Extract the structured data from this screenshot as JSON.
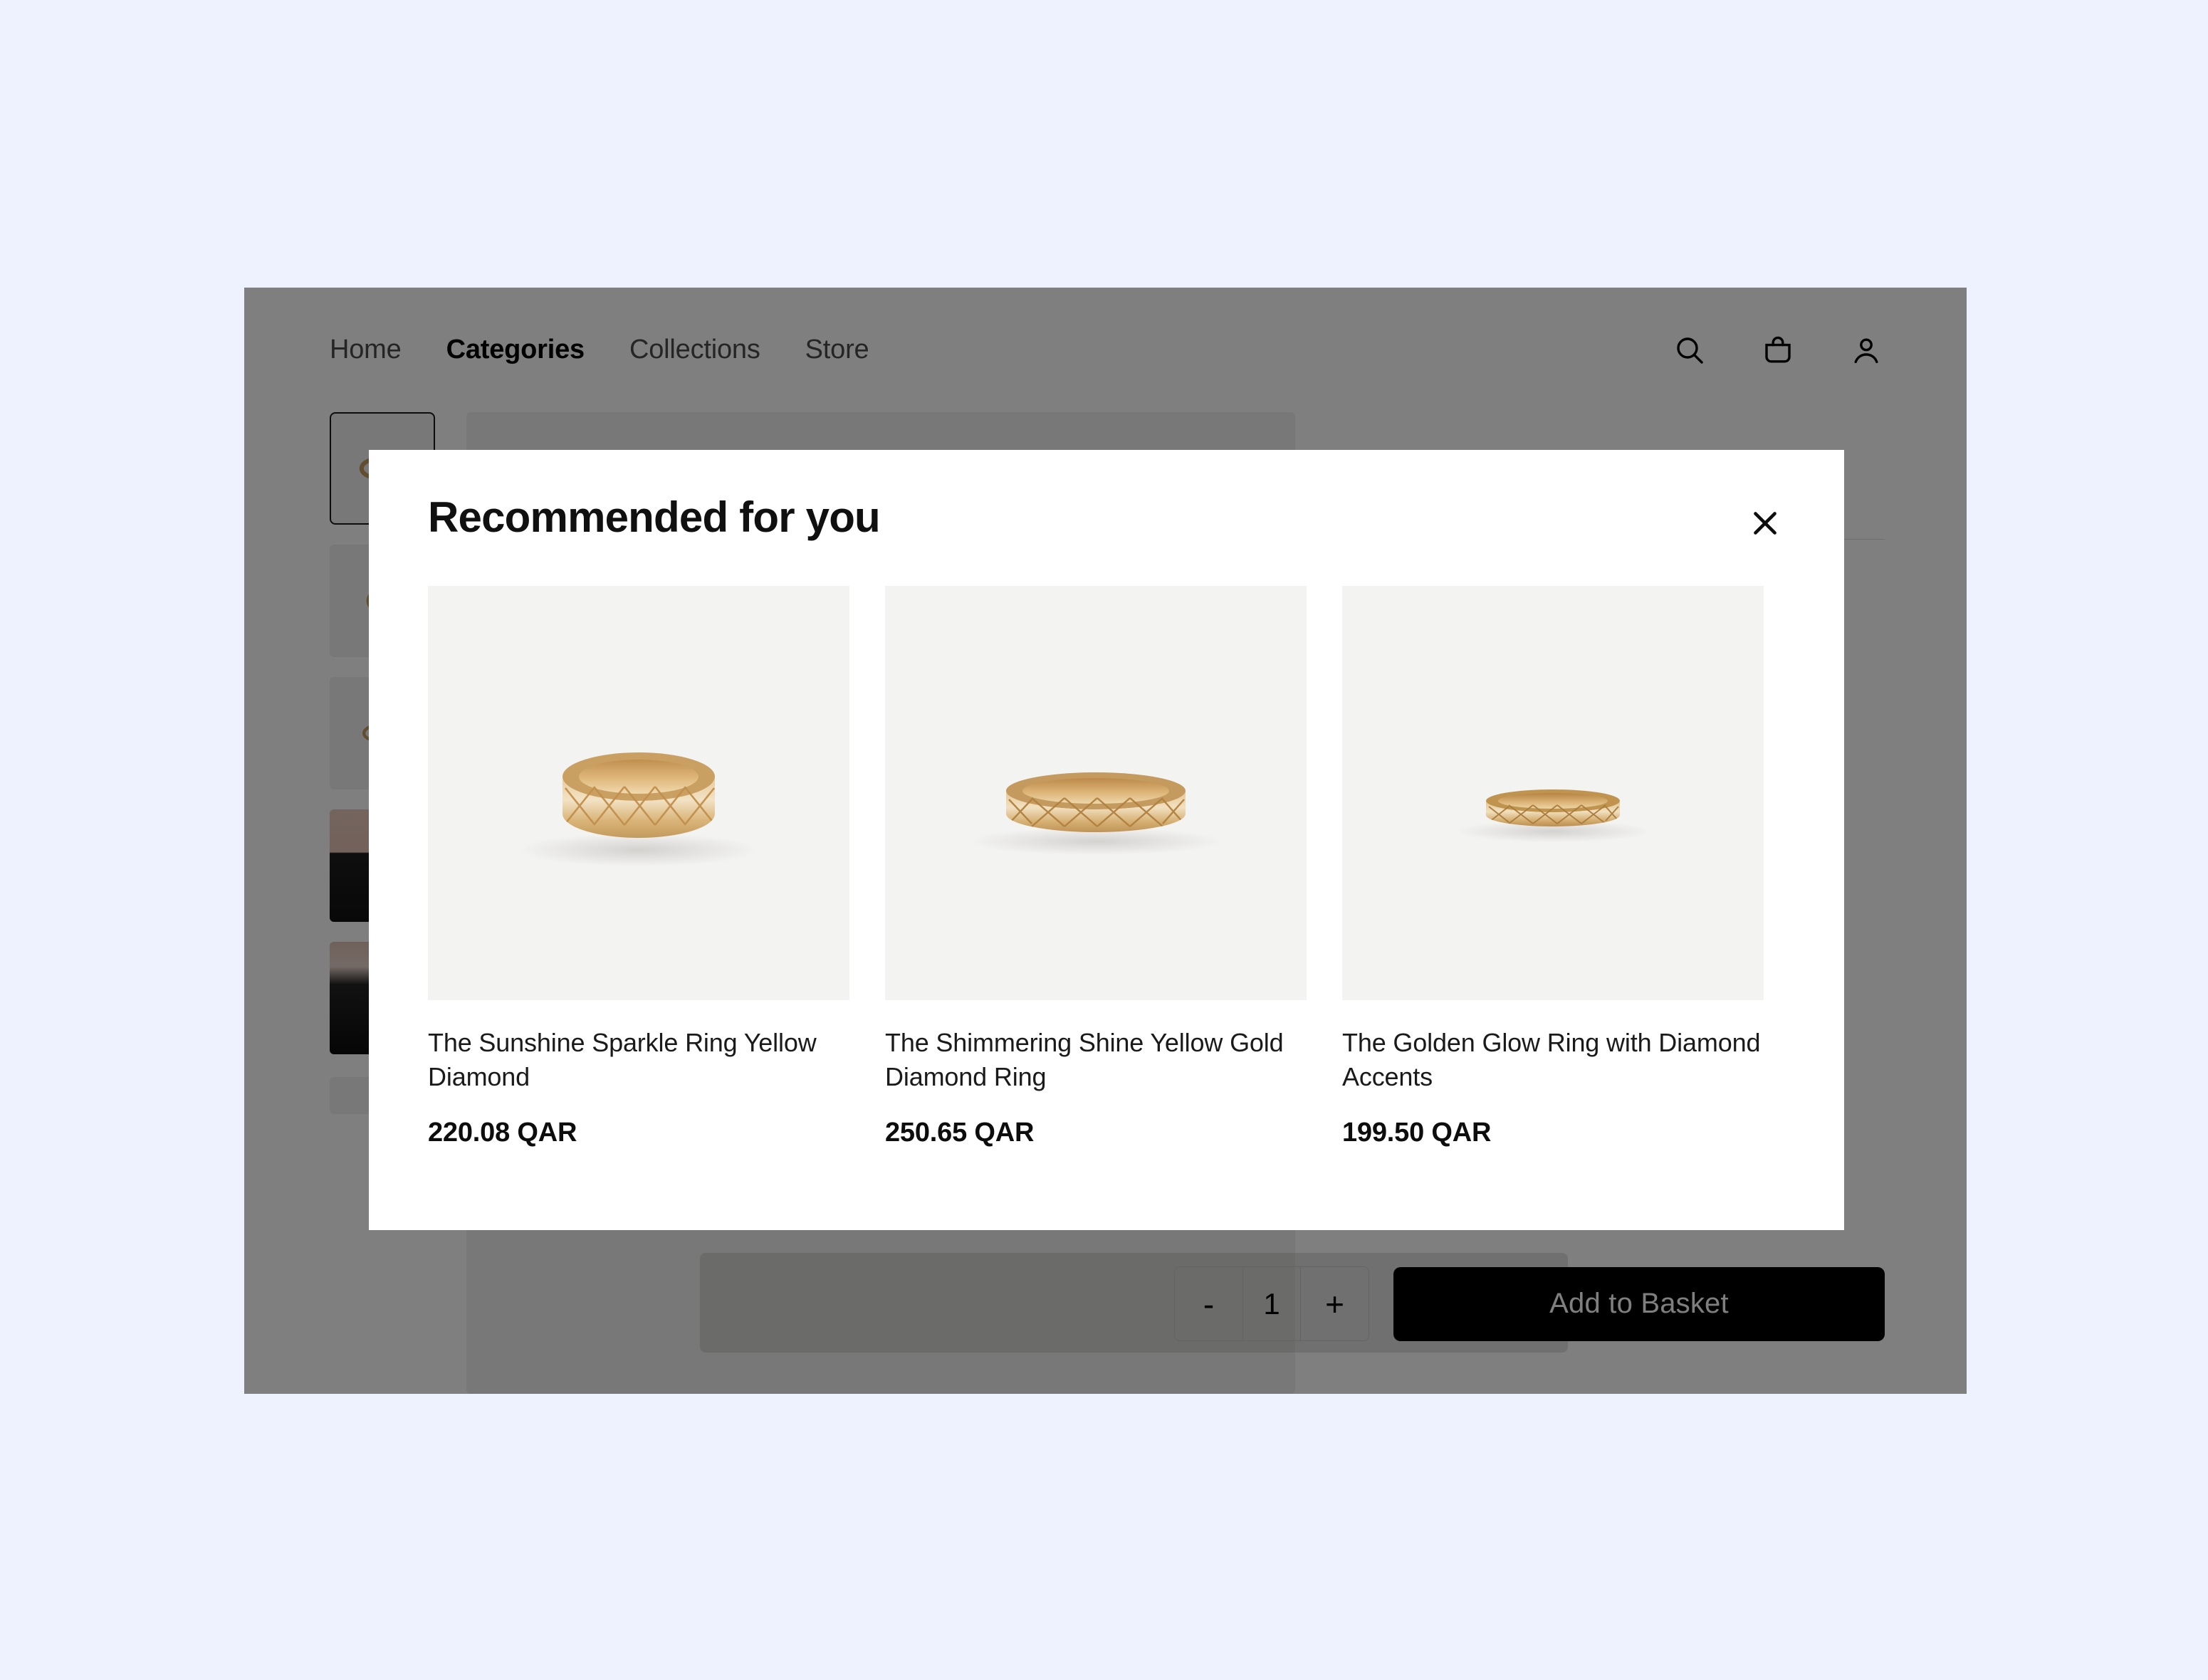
{
  "theme": {
    "page_background": "#eef1fe",
    "scrim": "rgba(0,0,0,0.5)",
    "modal_background": "#ffffff",
    "accent_dark": "#000000",
    "image_tile": "#f3f3f2",
    "gold": "#d9ae72"
  },
  "header": {
    "nav": [
      {
        "label": "Home",
        "active": false
      },
      {
        "label": "Categories",
        "active": true
      },
      {
        "label": "Collections",
        "active": false
      },
      {
        "label": "Store",
        "active": false
      }
    ],
    "actions": [
      {
        "icon": "search-icon",
        "label": "Search"
      },
      {
        "icon": "shopping-bag-icon",
        "label": "Basket"
      },
      {
        "icon": "user-icon",
        "label": "Account"
      }
    ]
  },
  "product_page": {
    "thumbnails": [
      {
        "name": "thumbnail-ring-front",
        "kind": "ring",
        "selected": true
      },
      {
        "name": "thumbnail-ring-angled",
        "kind": "ring",
        "selected": false
      },
      {
        "name": "thumbnail-ring-side",
        "kind": "ring",
        "selected": false
      },
      {
        "name": "thumbnail-model-portrait",
        "kind": "model",
        "selected": false
      },
      {
        "name": "thumbnail-model-hand",
        "kind": "model-b",
        "selected": false
      }
    ],
    "more_thumbnails_icon": "chevron-down-icon",
    "purchase": {
      "decrease_label": "-",
      "quantity": "1",
      "increase_label": "+",
      "add_to_basket_label": "Add to Basket"
    }
  },
  "modal": {
    "title": "Recommended for you",
    "close_icon": "close-icon",
    "close_label": "Close",
    "products": [
      {
        "title": "The Sunshine Sparkle Ring Yellow Diamond",
        "price": "220.08 QAR",
        "image": "gold-quilted-ring-wide"
      },
      {
        "title": "The Shimmering Shine Yellow Gold Diamond Ring",
        "price": "250.65 QAR",
        "image": "gold-quilted-ring-medium"
      },
      {
        "title": "The Golden Glow Ring with Diamond Accents",
        "price": "199.50 QAR",
        "image": "gold-quilted-ring-slim"
      }
    ]
  }
}
